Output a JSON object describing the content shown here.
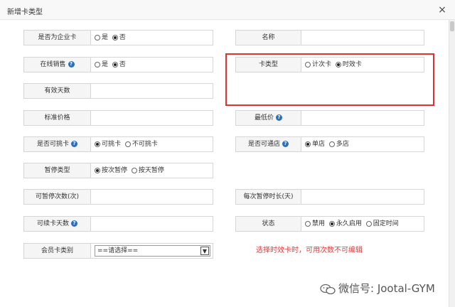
{
  "dialog": {
    "title": "新增卡类型",
    "close_glyph": "×"
  },
  "fields": {
    "is_enterprise_card": {
      "label": "是否为企业卡",
      "options": [
        "是",
        "否"
      ],
      "selected": 1
    },
    "name": {
      "label": "名称",
      "value": ""
    },
    "online_sale": {
      "label": "在线销售",
      "options": [
        "是",
        "否"
      ],
      "selected": 1
    },
    "card_type": {
      "label": "卡类型",
      "options": [
        "计次卡",
        "时效卡"
      ],
      "selected": 1
    },
    "valid_days": {
      "label": "有效天数",
      "value": ""
    },
    "standard_price": {
      "label": "标准价格",
      "value": ""
    },
    "min_price": {
      "label": "最低价",
      "value": ""
    },
    "transferable": {
      "label": "是否可挑卡",
      "options": [
        "可挑卡",
        "不可挑卡"
      ],
      "selected": 0
    },
    "multi_store": {
      "label": "是否可通店",
      "options": [
        "单店",
        "多店"
      ],
      "selected": 0
    },
    "pause_type": {
      "label": "暂停类型",
      "options": [
        "按次暂停",
        "按天暂停"
      ],
      "selected": 0
    },
    "pause_count": {
      "label": "可暂停次数(次)",
      "value": ""
    },
    "pause_duration": {
      "label": "每次暂停时长(天)",
      "value": ""
    },
    "renew_days": {
      "label": "可续卡天数",
      "value": ""
    },
    "status": {
      "label": "状态",
      "options": [
        "禁用",
        "永久启用",
        "固定时间"
      ],
      "selected": 1
    },
    "member_category": {
      "label": "会员卡类别",
      "selected_value": "==请选择=="
    }
  },
  "note": "选择时效卡时，可用次数不可编辑",
  "watermark": "微信号: Jootal-GYM",
  "colors": {
    "note_red": "#e03a3a",
    "help_blue": "#2c6fbd",
    "label_bg": "#f5f5f5"
  }
}
